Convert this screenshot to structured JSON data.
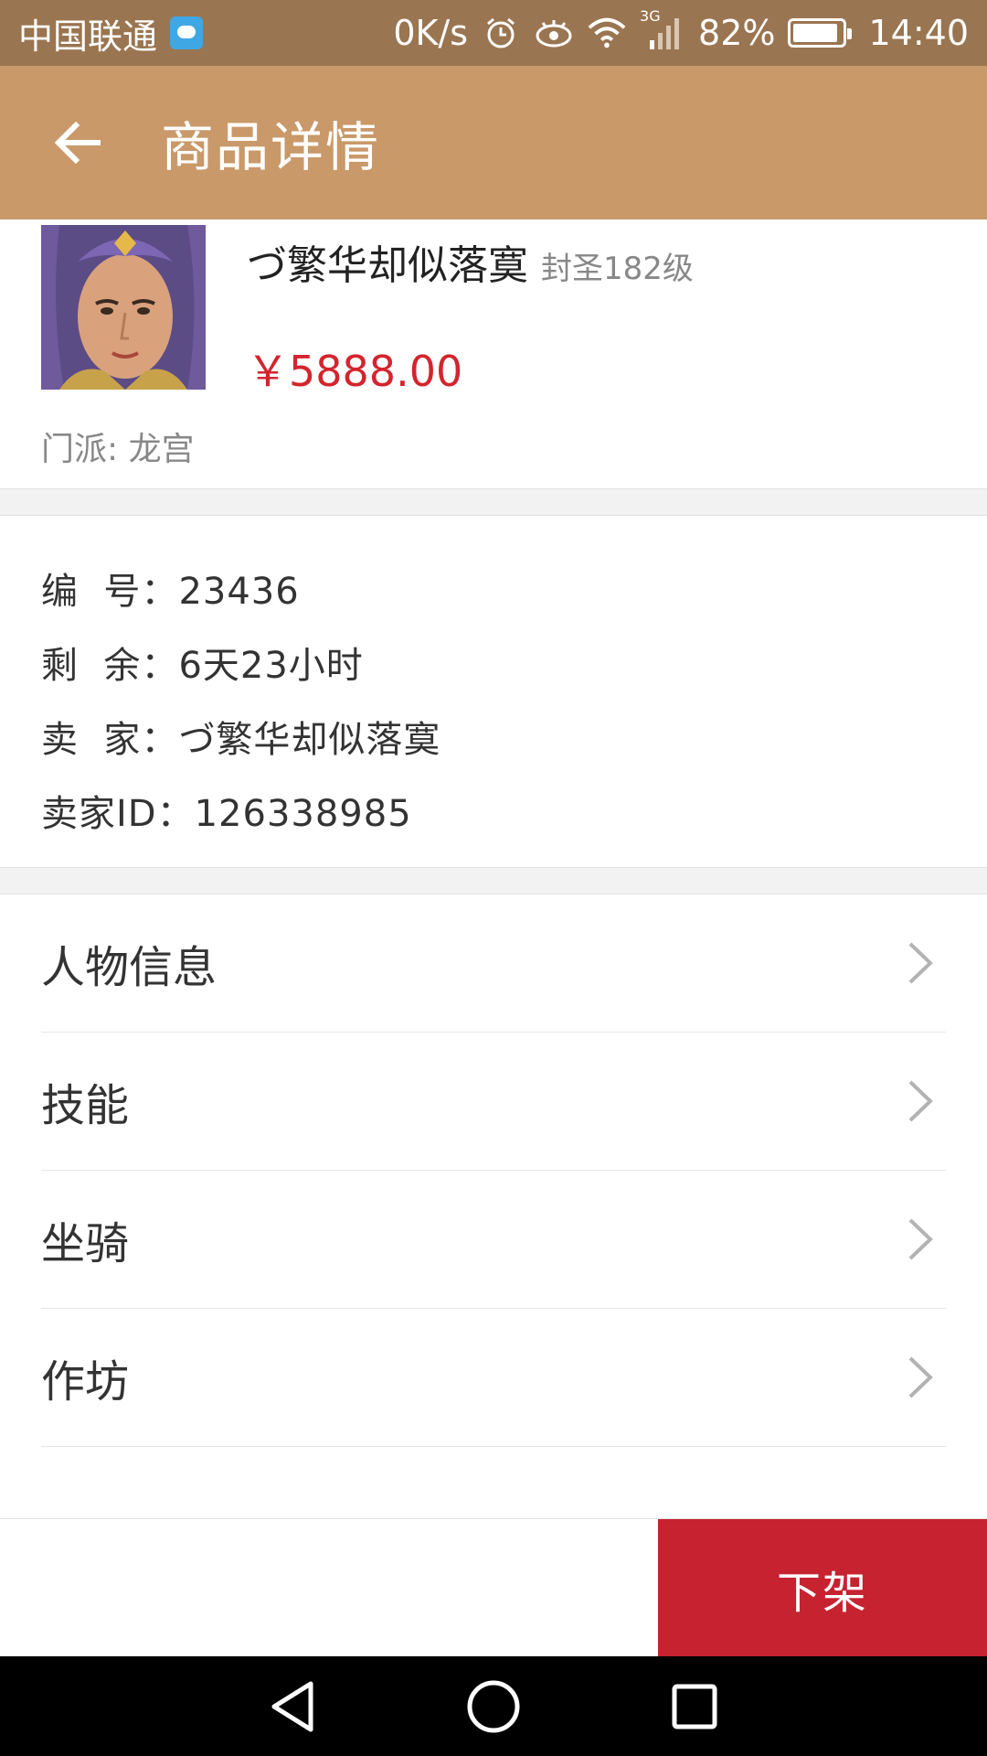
{
  "status_bar": {
    "carrier": "中国联通",
    "net_speed": "0K/s",
    "network_type": "3G",
    "battery": "82%",
    "time": "14:40",
    "icons": [
      "message-icon",
      "alarm-icon",
      "eye-icon",
      "wifi-icon",
      "signal-icon",
      "battery-icon"
    ]
  },
  "app_bar": {
    "title": "商品详情",
    "back_icon": "arrow-left-icon"
  },
  "product": {
    "name": "づ繁华却似落寞",
    "level": "封圣182级",
    "price": "￥5888.00",
    "faction": "门派: 龙宫"
  },
  "info": {
    "rows": [
      {
        "label": "编  号：",
        "value": "23436"
      },
      {
        "label": "剩  余：",
        "value": "6天23小时"
      },
      {
        "label": "卖  家：",
        "value": "づ繁华却似落寞"
      },
      {
        "label": "卖家ID：",
        "value": "126338985"
      }
    ]
  },
  "menu": {
    "items": [
      {
        "label": "人物信息"
      },
      {
        "label": "技能"
      },
      {
        "label": "坐骑"
      },
      {
        "label": "作坊"
      }
    ],
    "chevron_icon": "chevron-right-icon"
  },
  "action_bar": {
    "delist_label": "下架"
  },
  "colors": {
    "status_bar": "#9a7551",
    "app_bar": "#c9996a",
    "price": "#d4242e",
    "delist_button": "#c7222f"
  }
}
